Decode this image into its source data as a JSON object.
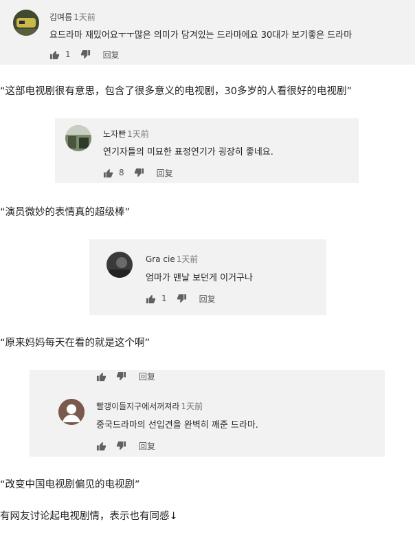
{
  "comments": [
    {
      "user": "김여름",
      "time": "1天前",
      "text": "요드라마 재밌어요ㅜㅜ많은 의미가 담겨있는 드라마에요 30대가 보기좋은 드라마",
      "likes": "1",
      "reply": "回复"
    },
    {
      "user": "노자빤",
      "time": "1天前",
      "text": "연기자들의 미묘한 표정연기가 굉장히 좋네요.",
      "likes": "8",
      "reply": "回复"
    },
    {
      "user": "Gra cie",
      "time": "1天前",
      "text": "엄마가 맨날 보던게 이거구나",
      "likes": "1",
      "reply": "回复"
    },
    {
      "user": "",
      "time": "",
      "text": "",
      "likes": "",
      "reply": "回复"
    },
    {
      "user": "빨갱이들지구에서꺼져라",
      "time": "1天前",
      "text": "중국드라마의 선입견을 완벽히 깨준 드라마.",
      "likes": "",
      "reply": "回复"
    }
  ],
  "translations": [
    "“这部电视剧很有意思，包含了很多意义的电视剧，30多岁的人看很好的电视剧”",
    "“演员微妙的表情真的超级棒”",
    "“原来妈妈每天在看的就是这个啊”",
    "“改变中国电视剧偏见的电视剧”"
  ],
  "closing": "有网友讨论起电视剧情，表示也有同感↓",
  "icons": {
    "like": "thumb-up-icon",
    "dislike": "thumb-down-icon"
  }
}
